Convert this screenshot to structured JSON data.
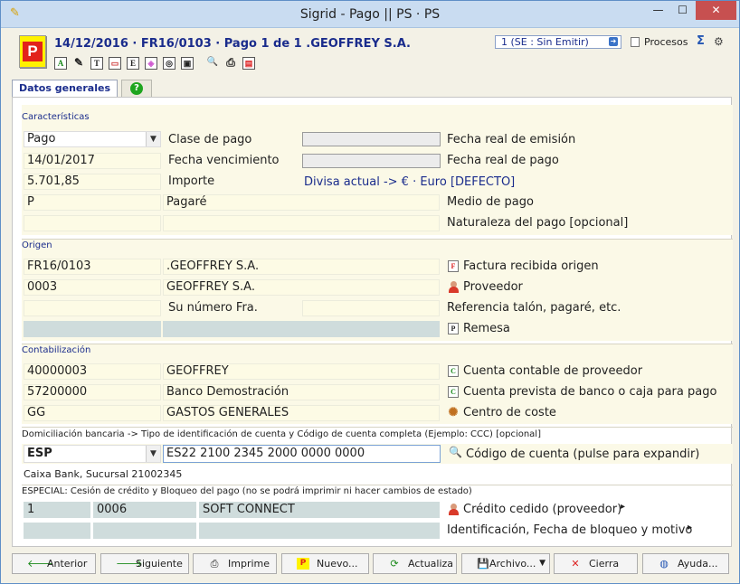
{
  "window": {
    "title": "Sigrid - Pago || PS · PS",
    "minimize": "—",
    "maximize": "☐",
    "close": "✕"
  },
  "header": {
    "title": "14/12/2016 · FR16/0103 · Pago 1 de 1 .GEOFFREY S.A.",
    "state": "1 (SE : Sin Emitir)",
    "procesos": "Procesos",
    "doc_icon_letter": "P",
    "toolbar_icons": [
      "A",
      "✎",
      "T",
      "▭",
      "E",
      "◈",
      "◎",
      "▣",
      "🔍",
      "⎙",
      "▤"
    ]
  },
  "tabs": {
    "main": "Datos generales",
    "help": "?"
  },
  "caracteristicas": {
    "header": "Características",
    "clase_pago": {
      "value": "Pago",
      "label": "Clase de pago"
    },
    "fecha_emision_label": "Fecha real de emisión",
    "fecha_venc": {
      "value": "14/01/2017",
      "label": "Fecha vencimiento"
    },
    "fecha_pago_label": "Fecha real de pago",
    "importe": {
      "value": "5.701,85",
      "label": "Importe"
    },
    "divisa": "Divisa actual -> € · Euro [DEFECTO]",
    "medio_pago": {
      "code": "P",
      "name": "Pagaré",
      "label": "Medio de pago"
    },
    "naturaleza_label": "Naturaleza del pago [opcional]"
  },
  "origen": {
    "header": "Origen",
    "factura": {
      "code": "FR16/0103",
      "name": ".GEOFFREY S.A.",
      "label": "Factura recibida origen"
    },
    "proveedor": {
      "code": "0003",
      "name": "GEOFFREY S.A.",
      "label": "Proveedor"
    },
    "su_numero_label": "Su número Fra.",
    "referencia_label": "Referencia talón, pagaré, etc.",
    "remesa_label": "Remesa"
  },
  "contabilizacion": {
    "header": "Contabilización",
    "cuenta_proveedor": {
      "code": "40000003",
      "name": "GEOFFREY",
      "label": "Cuenta contable de proveedor"
    },
    "cuenta_banco": {
      "code": "57200000",
      "name": "Banco Demostración",
      "label": "Cuenta prevista de banco o caja para pago"
    },
    "centro_coste": {
      "code": "GG",
      "name": "GASTOS GENERALES",
      "label": "Centro de coste"
    }
  },
  "domiciliacion": {
    "header": "Domiciliación bancaria -> Tipo de identificación de cuenta y Código de cuenta completa (Ejemplo: CCC) [opcional]",
    "tipo": "ESP",
    "codigo": "ES22 2100 2345 2000 0000 0000",
    "label": "Código de cuenta (pulse para expandir)",
    "banco": "Caixa Bank, Sucursal 21002345"
  },
  "especial": {
    "header": "ESPECIAL: Cesión de crédito  y  Bloqueo del pago (no se podrá imprimir ni hacer cambios de estado)",
    "credito": {
      "flag": "1",
      "code": "0006",
      "name": "SOFT CONNECT",
      "label": "Crédito cedido (proveedor)"
    },
    "bloqueo_label": "Identificación, Fecha de bloqueo y motivo"
  },
  "buttons": {
    "anterior": "Anterior",
    "siguiente": "Siguiente",
    "imprime": "Imprime",
    "nuevo": "Nuevo...",
    "actualiza": "Actualiza",
    "archivo": "Archivo...",
    "cierra": "Cierra",
    "ayuda": "Ayuda..."
  }
}
